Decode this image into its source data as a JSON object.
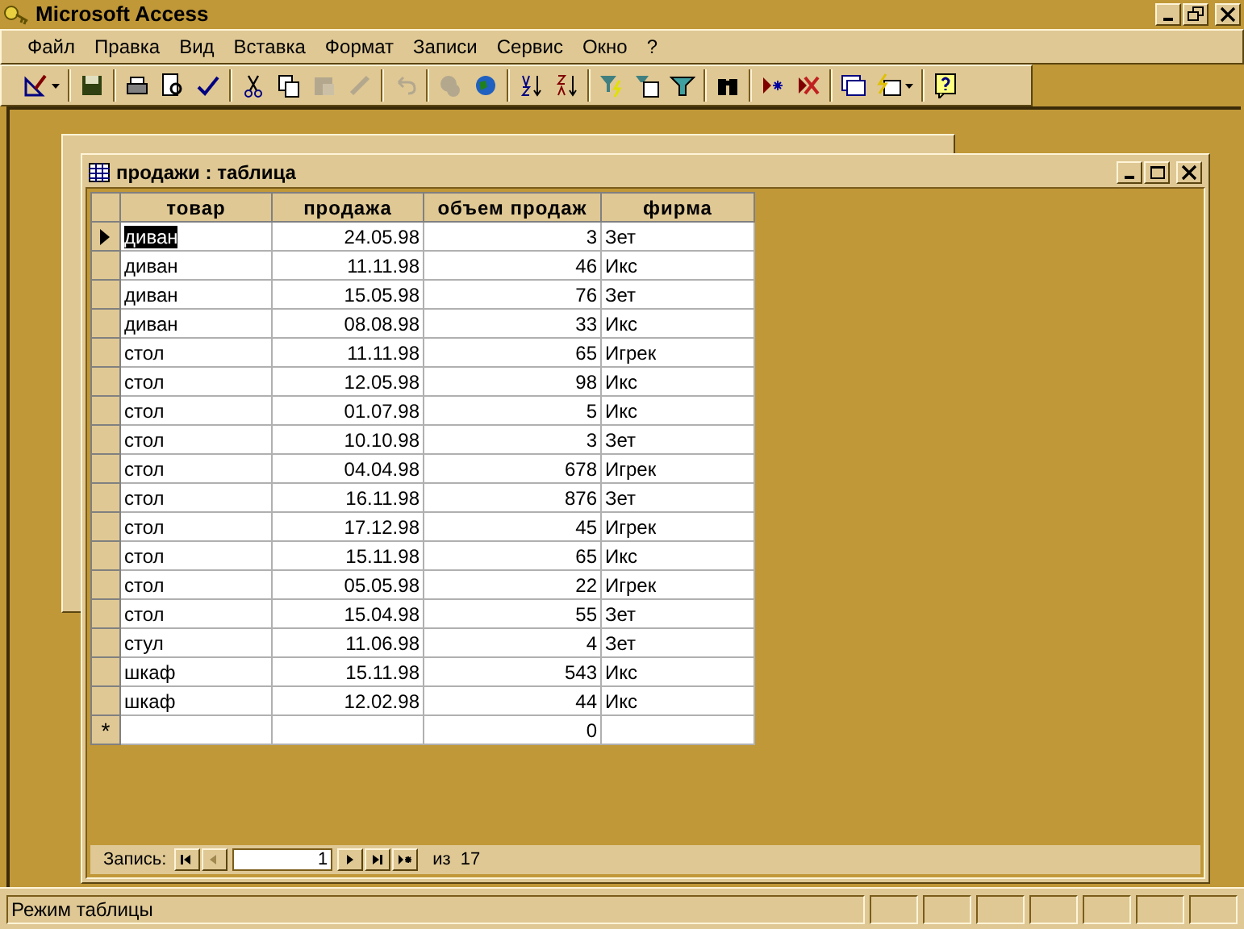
{
  "window": {
    "title": "Microsoft Access"
  },
  "menu": [
    "Файл",
    "Правка",
    "Вид",
    "Вставка",
    "Формат",
    "Записи",
    "Сервис",
    "Окно",
    "?"
  ],
  "toolbar": [
    {
      "kind": "design",
      "disabled": false
    },
    {
      "kind": "sep"
    },
    {
      "kind": "save",
      "disabled": false
    },
    {
      "kind": "sep"
    },
    {
      "kind": "print",
      "disabled": false
    },
    {
      "kind": "preview",
      "disabled": false
    },
    {
      "kind": "spell",
      "disabled": false
    },
    {
      "kind": "sep"
    },
    {
      "kind": "cut",
      "disabled": false
    },
    {
      "kind": "copy",
      "disabled": false
    },
    {
      "kind": "paste",
      "disabled": true
    },
    {
      "kind": "brush",
      "disabled": true
    },
    {
      "kind": "sep"
    },
    {
      "kind": "undo",
      "disabled": true
    },
    {
      "kind": "sep"
    },
    {
      "kind": "links",
      "disabled": true
    },
    {
      "kind": "web",
      "disabled": false
    },
    {
      "kind": "sep"
    },
    {
      "kind": "sortasc",
      "disabled": false
    },
    {
      "kind": "sortdesc",
      "disabled": false
    },
    {
      "kind": "sep"
    },
    {
      "kind": "filtersel",
      "disabled": false
    },
    {
      "kind": "filterform",
      "disabled": false
    },
    {
      "kind": "filter",
      "disabled": false
    },
    {
      "kind": "sep"
    },
    {
      "kind": "find",
      "disabled": false
    },
    {
      "kind": "sep"
    },
    {
      "kind": "newrec",
      "disabled": false
    },
    {
      "kind": "delrec",
      "disabled": false
    },
    {
      "kind": "sep"
    },
    {
      "kind": "dbwin",
      "disabled": false
    },
    {
      "kind": "newobj",
      "disabled": false
    },
    {
      "kind": "sep"
    },
    {
      "kind": "help",
      "disabled": false
    }
  ],
  "datasheet": {
    "title": "продажи : таблица",
    "columns": [
      "товар",
      "продажа",
      "объем продаж",
      "фирма"
    ],
    "rows": [
      {
        "selected": true,
        "cells": [
          "диван",
          "24.05.98",
          "3",
          "Зет"
        ]
      },
      {
        "selected": false,
        "cells": [
          "диван",
          "11.11.98",
          "46",
          "Икс"
        ]
      },
      {
        "selected": false,
        "cells": [
          "диван",
          "15.05.98",
          "76",
          "Зет"
        ]
      },
      {
        "selected": false,
        "cells": [
          "диван",
          "08.08.98",
          "33",
          "Икс"
        ]
      },
      {
        "selected": false,
        "cells": [
          "стол",
          "11.11.98",
          "65",
          "Игрек"
        ]
      },
      {
        "selected": false,
        "cells": [
          "стол",
          "12.05.98",
          "98",
          "Икс"
        ]
      },
      {
        "selected": false,
        "cells": [
          "стол",
          "01.07.98",
          "5",
          "Икс"
        ]
      },
      {
        "selected": false,
        "cells": [
          "стол",
          "10.10.98",
          "3",
          "Зет"
        ]
      },
      {
        "selected": false,
        "cells": [
          "стол",
          "04.04.98",
          "678",
          "Игрек"
        ]
      },
      {
        "selected": false,
        "cells": [
          "стол",
          "16.11.98",
          "876",
          "Зет"
        ]
      },
      {
        "selected": false,
        "cells": [
          "стол",
          "17.12.98",
          "45",
          "Игрек"
        ]
      },
      {
        "selected": false,
        "cells": [
          "стол",
          "15.11.98",
          "65",
          "Икс"
        ]
      },
      {
        "selected": false,
        "cells": [
          "стол",
          "05.05.98",
          "22",
          "Игрек"
        ]
      },
      {
        "selected": false,
        "cells": [
          "стол",
          "15.04.98",
          "55",
          "Зет"
        ]
      },
      {
        "selected": false,
        "cells": [
          "стул",
          "11.06.98",
          "4",
          "Зет"
        ]
      },
      {
        "selected": false,
        "cells": [
          "шкаф",
          "15.11.98",
          "543",
          "Икс"
        ]
      },
      {
        "selected": false,
        "cells": [
          "шкаф",
          "12.02.98",
          "44",
          "Икс"
        ]
      }
    ],
    "new_row": {
      "marker": "*",
      "cells": [
        "",
        "",
        "0",
        ""
      ]
    },
    "navigator": {
      "label": "Запись:",
      "value": "1",
      "of": "из",
      "total": "17"
    }
  },
  "status_bar": {
    "text": "Режим таблицы"
  }
}
